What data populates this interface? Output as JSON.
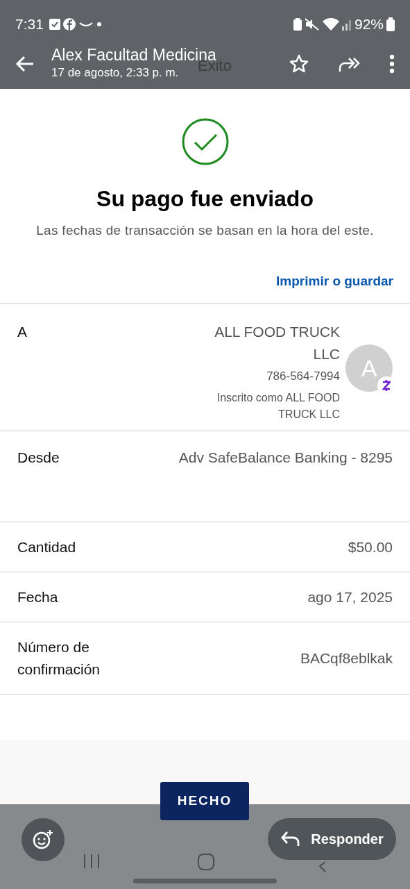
{
  "status_bar": {
    "time": "7:31",
    "battery": "92%"
  },
  "header": {
    "sender": "Alex Facultad Medicina",
    "date": "17 de agosto, 2:33 p. m."
  },
  "screenshot": {
    "title": "Exito",
    "heading": "Su pago fue enviado",
    "note": "Las fechas de transacción se basan en la hora del este.",
    "print_link": "Imprimir o guardar",
    "recipient": {
      "label": "A",
      "name": "ALL FOOD TRUCK LLC",
      "phone": "786-564-7994",
      "enrolled_as": "Inscrito como ALL FOOD TRUCK LLC",
      "avatar_initial": "A"
    },
    "details": [
      {
        "label": "Desde",
        "value": "Adv SafeBalance Banking - 8295"
      },
      {
        "label": "Cantidad",
        "value": "$50.00"
      },
      {
        "label": "Fecha",
        "value": "ago 17, 2025"
      },
      {
        "label": "Número de confirmación",
        "value": "BACqf8eblkak"
      }
    ],
    "done_button": "HECHO"
  },
  "actions": {
    "reply": "Responder"
  }
}
